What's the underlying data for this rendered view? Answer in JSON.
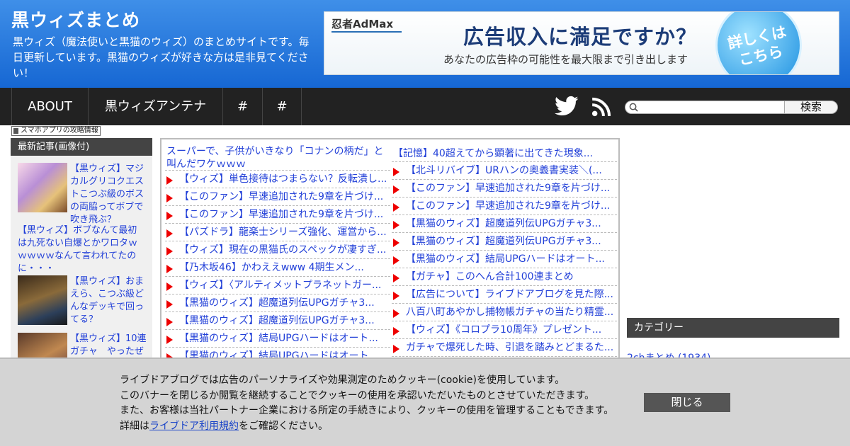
{
  "header": {
    "title": "黒ウィズまとめ",
    "description": "黒ウィズ（魔法使いと黒猫のウィズ）のまとめサイトです。毎日更新しています。黒猫のウィズが好きな方は是非見てください！"
  },
  "ad": {
    "brand": "忍者AdMax",
    "headline": "広告収入に満足ですか？",
    "subtext": "あなたの広告枠の可能性を最大限まで引き出します",
    "cta_line1": "詳しくは",
    "cta_line2": "こちら"
  },
  "nav": {
    "items": [
      "ABOUT",
      "黒ウィズアンテナ",
      "#",
      "#"
    ],
    "search_button": "検索",
    "search_placeholder": ""
  },
  "app_link": "スマホアプリの攻略情報",
  "sidebar_left": {
    "heading": "最新記事(画像付)",
    "items": [
      "【黒ウィズ】マジカルグリコクエストこつぶ級のボスの両脇ってボブで吹き飛ぶ？",
      "【黒ウィズ】ボブなんて最初は九死ない自爆とかワロタｗｗｗｗｗなんて言われてたのに・・・",
      "【黒ウィズ】おまえら、こつぶ級どんなデッキで回ってる？",
      "【黒ウィズ】10連ガチャ　やったぜ"
    ]
  },
  "articles": {
    "left": [
      "スーパーで、子供がいきなり「コナンの柄だ」と叫んだワケｗｗｗ",
      "【ウィズ】単色接待はつまらない？反転潰し...",
      "【このファン】早速追加された9章を片づけ...",
      "【このファン】早速追加された9章を片づけ...",
      "【パズドラ】龍楽士シリーズ強化、運営から...",
      "【ウィズ】現在の黒猫氏のスペックが凄すぎ...",
      "【乃木坂46】かわええwww 4期生メン...",
      "【ウィズ】〈アルティメットプラネットガー...",
      "【黒猫のウィズ】超魔道列伝UPGガチャ3...",
      "【黒猫のウィズ】超魔道列伝UPGガチャ3...",
      "【黒猫のウィズ】結局UPGハードはオート...",
      "【黒猫のウィズ】結局UPGハードはオート..."
    ],
    "right": [
      "【記憶】40超えてから顕著に出てきた現象...",
      "【北斗リバイブ】URハンの奥義書実装＼(...",
      "【このファン】早速追加された9章を片づけ...",
      "【このファン】早速追加された9章を片づけ...",
      "【黒猫のウィズ】超魔道列伝UPGガチャ3...",
      "【黒猫のウィズ】超魔道列伝UPGガチャ3...",
      "【黒猫のウィズ】結局UPGハードはオート...",
      "【ガチャ】このへん合計100連まとめ",
      "【広告について】ライブドアブログを見た際...",
      "八百八町あやかし捕物帳ガチャの当たり精霊...",
      "【ウィズ】《コロプラ10周年》プレゼント...",
      "ガチャで爆死した時、引退を踏みとどまるた..."
    ]
  },
  "sidebar_right": {
    "category_heading": "カテゴリー",
    "first_category": "2chまとめ (1934)"
  },
  "cookie": {
    "line1": "ライブドアブログでは広告のパーソナライズや効果測定のためクッキー(cookie)を使用しています。",
    "line2": "このバナーを閉じるか閲覧を継続することでクッキーの使用を承認いただいたものとさせていただきます。",
    "line3": "また、お客様は当社パートナー企業における所定の手続きにより、クッキーの使用を管理することもできます。",
    "line4_pre": "詳細は",
    "line4_link": "ライブドア利用規約",
    "line4_post": "をご確認ください。",
    "close_button": "閉じる"
  },
  "colors": {
    "header": "#1667d3",
    "nav": "#222222",
    "link": "#2240d8",
    "arrow": "#ee0000"
  }
}
